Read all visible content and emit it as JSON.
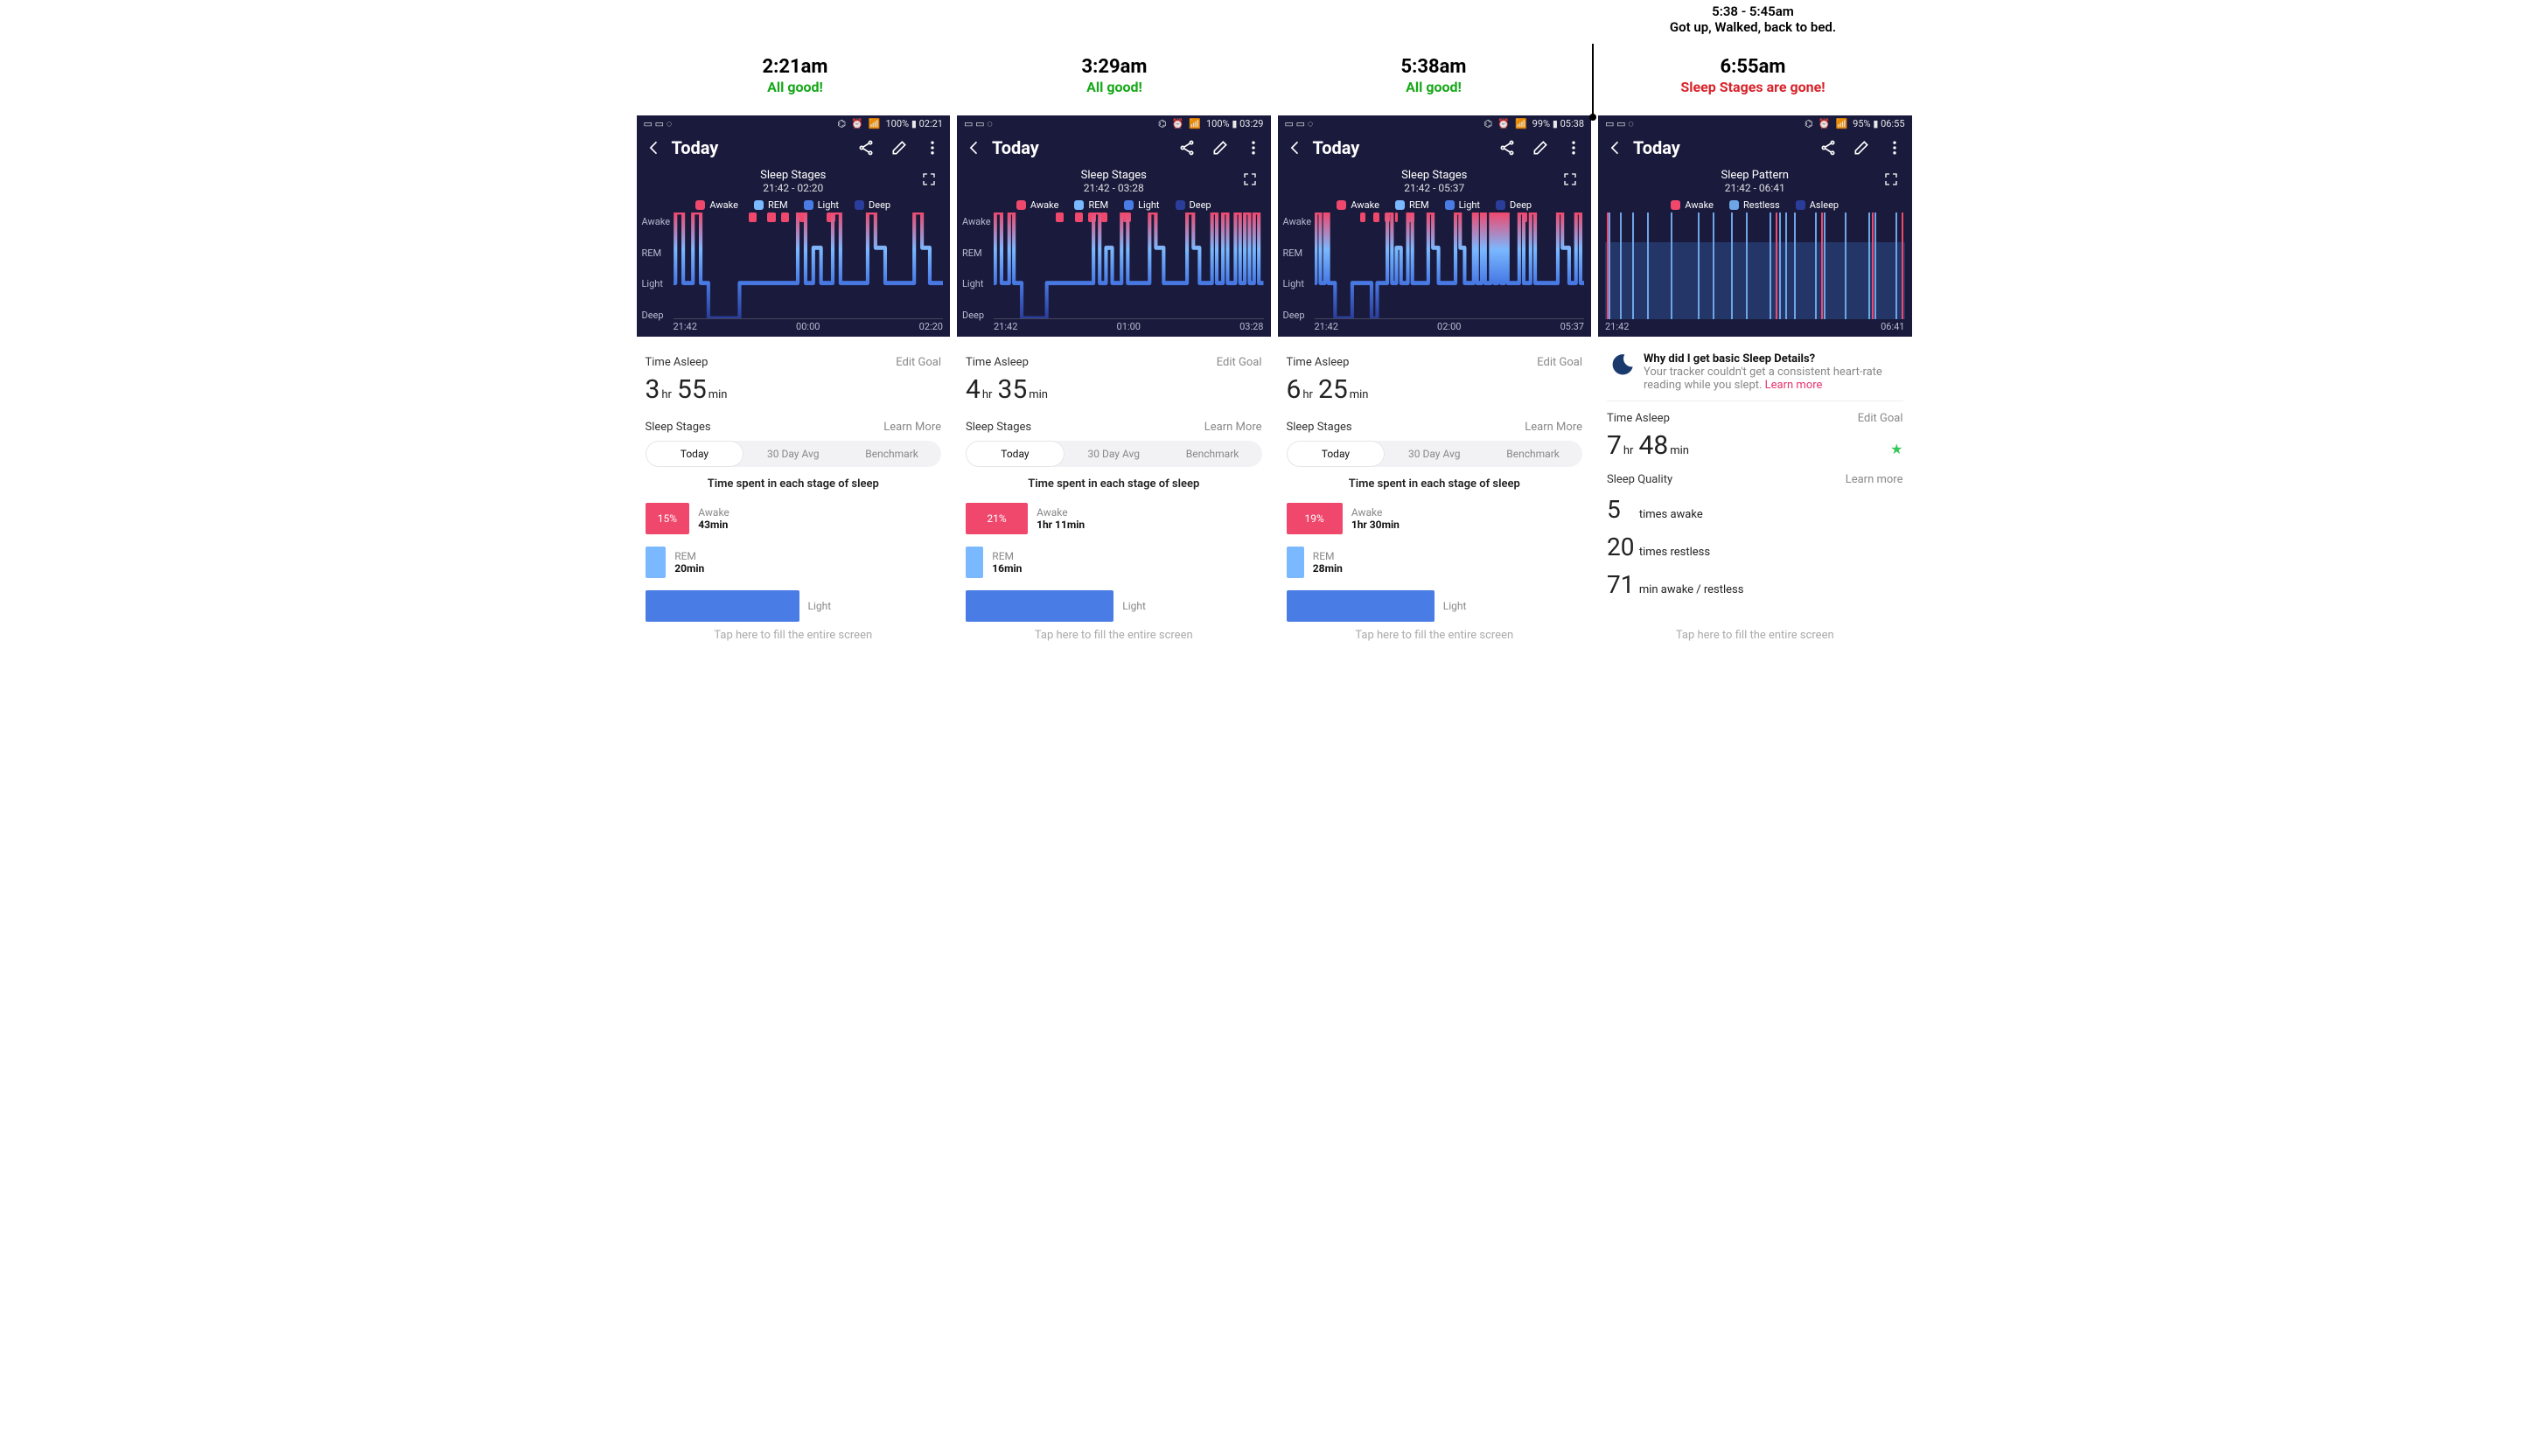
{
  "colors": {
    "awake": "#f0486d",
    "rem": "#7ab8ff",
    "light": "#4a7ce6",
    "deep": "#2a3d9a",
    "restless": "#6da5e6",
    "asleep": "#2a3d9a",
    "panel_fill": "#2e4d8a"
  },
  "callout": {
    "time": "5:38 - 5:45am",
    "note": "Got up, Walked, back to bed."
  },
  "phones": [
    {
      "ann_time": "2:21am",
      "ann_status": "All good!",
      "ann_color": "green",
      "status_right": "100% ▮ 02:21",
      "appbar_title": "Today",
      "chart_title": "Sleep Stages",
      "chart_range": "21:42 - 02:20",
      "legend": [
        "Awake",
        "REM",
        "Light",
        "Deep"
      ],
      "xticks": [
        "21:42",
        "00:00",
        "02:20"
      ],
      "ylabels": [
        "Awake",
        "REM",
        "Light",
        "Deep"
      ],
      "time_asleep_label": "Time Asleep",
      "edit_goal": "Edit Goal",
      "time_asleep": {
        "h": "3",
        "m": "55"
      },
      "stages_label": "Sleep Stages",
      "learn_more": "Learn More",
      "tabs": [
        "Today",
        "30 Day Avg",
        "Benchmark"
      ],
      "tabs_caption": "Time spent in each stage of sleep",
      "stage_rows": [
        {
          "pct": 15,
          "pct_label": "15%",
          "color": "#f0486d",
          "name": "Awake",
          "dur": "43min"
        },
        {
          "pct": 7,
          "pct_label": "",
          "color": "#7ab8ff",
          "name": "REM",
          "dur": "20min"
        },
        {
          "pct": 52,
          "pct_label": "",
          "color": "#4a7ce6",
          "name": "Light",
          "dur": ""
        }
      ],
      "footer": "Tap here to fill the entire screen"
    },
    {
      "ann_time": "3:29am",
      "ann_status": "All good!",
      "ann_color": "green",
      "status_right": "100% ▮ 03:29",
      "appbar_title": "Today",
      "chart_title": "Sleep Stages",
      "chart_range": "21:42 - 03:28",
      "legend": [
        "Awake",
        "REM",
        "Light",
        "Deep"
      ],
      "xticks": [
        "21:42",
        "01:00",
        "03:28"
      ],
      "ylabels": [
        "Awake",
        "REM",
        "Light",
        "Deep"
      ],
      "time_asleep_label": "Time Asleep",
      "edit_goal": "Edit Goal",
      "time_asleep": {
        "h": "4",
        "m": "35"
      },
      "stages_label": "Sleep Stages",
      "learn_more": "Learn More",
      "tabs": [
        "Today",
        "30 Day Avg",
        "Benchmark"
      ],
      "tabs_caption": "Time spent in each stage of sleep",
      "stage_rows": [
        {
          "pct": 21,
          "pct_label": "21%",
          "color": "#f0486d",
          "name": "Awake",
          "dur": "1hr 11min"
        },
        {
          "pct": 6,
          "pct_label": "",
          "color": "#7ab8ff",
          "name": "REM",
          "dur": "16min"
        },
        {
          "pct": 50,
          "pct_label": "",
          "color": "#4a7ce6",
          "name": "Light",
          "dur": ""
        }
      ],
      "footer": "Tap here to fill the entire screen"
    },
    {
      "ann_time": "5:38am",
      "ann_status": "All good!",
      "ann_color": "green",
      "status_right": "99% ▮ 05:38",
      "appbar_title": "Today",
      "chart_title": "Sleep Stages",
      "chart_range": "21:42 - 05:37",
      "legend": [
        "Awake",
        "REM",
        "Light",
        "Deep"
      ],
      "xticks": [
        "21:42",
        "02:00",
        "05:37"
      ],
      "ylabels": [
        "Awake",
        "REM",
        "Light",
        "Deep"
      ],
      "time_asleep_label": "Time Asleep",
      "edit_goal": "Edit Goal",
      "time_asleep": {
        "h": "6",
        "m": "25"
      },
      "stages_label": "Sleep Stages",
      "learn_more": "Learn More",
      "tabs": [
        "Today",
        "30 Day Avg",
        "Benchmark"
      ],
      "tabs_caption": "Time spent in each stage of sleep",
      "stage_rows": [
        {
          "pct": 19,
          "pct_label": "19%",
          "color": "#f0486d",
          "name": "Awake",
          "dur": "1hr 30min"
        },
        {
          "pct": 6,
          "pct_label": "",
          "color": "#7ab8ff",
          "name": "REM",
          "dur": "28min"
        },
        {
          "pct": 50,
          "pct_label": "",
          "color": "#4a7ce6",
          "name": "Light",
          "dur": ""
        }
      ],
      "footer": "Tap here to fill the entire screen"
    },
    {
      "ann_time": "6:55am",
      "ann_status": "Sleep Stages are gone!",
      "ann_color": "red",
      "status_right": "95% ▮ 06:55",
      "appbar_title": "Today",
      "chart_title": "Sleep Pattern",
      "chart_range": "21:42 - 06:41",
      "legend": [
        "Awake",
        "Restless",
        "Asleep"
      ],
      "xticks": [
        "21:42",
        "",
        "06:41"
      ],
      "notice": {
        "heading": "Why did I get basic Sleep Details?",
        "detail_a": "Your tracker couldn't get a consistent heart-rate reading while you slept. ",
        "link": "Learn more"
      },
      "time_asleep_label": "Time Asleep",
      "edit_goal": "Edit Goal",
      "time_asleep": {
        "h": "7",
        "m": "48"
      },
      "sq_label": "Sleep Quality",
      "learn_more": "Learn more",
      "sq_rows": [
        {
          "n": "5",
          "t": " times awake"
        },
        {
          "n": "20",
          "t": " times restless"
        },
        {
          "n": "71",
          "t": " min awake / restless"
        }
      ],
      "footer": "Tap here to fill the entire screen"
    }
  ],
  "chart_data": [
    {
      "type": "step-line",
      "title": "Sleep Stages",
      "time_range": "21:42 - 02:20",
      "x_range_minutes": [
        0,
        278
      ],
      "x_ticks": [
        "21:42",
        "00:00",
        "02:20"
      ],
      "y_levels": [
        "Awake",
        "REM",
        "Light",
        "Deep"
      ],
      "legend": [
        {
          "name": "Awake",
          "color": "#f0486d"
        },
        {
          "name": "REM",
          "color": "#7ab8ff"
        },
        {
          "name": "Light",
          "color": "#4a7ce6"
        },
        {
          "name": "Deep",
          "color": "#2a3d9a"
        }
      ],
      "awake_markers": [
        [
          28,
          31
        ],
        [
          35,
          38
        ],
        [
          40,
          43
        ],
        [
          47,
          49
        ],
        [
          57,
          60
        ],
        [
          132,
          134
        ],
        [
          204,
          207
        ]
      ],
      "steps": [
        [
          0,
          "Light"
        ],
        [
          2,
          "Awake"
        ],
        [
          10,
          "Light"
        ],
        [
          20,
          "Awake"
        ],
        [
          28,
          "Light"
        ],
        [
          36,
          "Deep"
        ],
        [
          68,
          "Light"
        ],
        [
          128,
          "Awake"
        ],
        [
          136,
          "Light"
        ],
        [
          144,
          "REM"
        ],
        [
          152,
          "Light"
        ],
        [
          164,
          "Awake"
        ],
        [
          172,
          "Light"
        ],
        [
          200,
          "Awake"
        ],
        [
          208,
          "REM"
        ],
        [
          218,
          "Light"
        ],
        [
          248,
          "Awake"
        ],
        [
          256,
          "REM"
        ],
        [
          264,
          "Light"
        ],
        [
          278,
          "Light"
        ]
      ]
    },
    {
      "type": "step-line",
      "title": "Sleep Stages",
      "time_range": "21:42 - 03:28",
      "x_range_minutes": [
        0,
        346
      ],
      "x_ticks": [
        "21:42",
        "01:00",
        "03:28"
      ],
      "y_levels": [
        "Awake",
        "REM",
        "Light",
        "Deep"
      ],
      "legend": [
        {
          "name": "Awake",
          "color": "#f0486d"
        },
        {
          "name": "REM",
          "color": "#7ab8ff"
        },
        {
          "name": "Light",
          "color": "#4a7ce6"
        },
        {
          "name": "Deep",
          "color": "#2a3d9a"
        }
      ],
      "awake_markers": [
        [
          23,
          26
        ],
        [
          30,
          33
        ],
        [
          35,
          38
        ],
        [
          40,
          42
        ],
        [
          48,
          51
        ],
        [
          106,
          108
        ],
        [
          164,
          166
        ]
      ],
      "steps": [
        [
          0,
          "Light"
        ],
        [
          2,
          "Awake"
        ],
        [
          10,
          "Light"
        ],
        [
          20,
          "Awake"
        ],
        [
          26,
          "Light"
        ],
        [
          36,
          "Deep"
        ],
        [
          68,
          "Light"
        ],
        [
          128,
          "Awake"
        ],
        [
          136,
          "Light"
        ],
        [
          144,
          "REM"
        ],
        [
          152,
          "Light"
        ],
        [
          164,
          "Awake"
        ],
        [
          172,
          "Light"
        ],
        [
          200,
          "Awake"
        ],
        [
          208,
          "REM"
        ],
        [
          218,
          "Light"
        ],
        [
          248,
          "Awake"
        ],
        [
          256,
          "REM"
        ],
        [
          264,
          "Light"
        ],
        [
          280,
          "Awake"
        ],
        [
          286,
          "Light"
        ],
        [
          294,
          "Awake"
        ],
        [
          300,
          "Light"
        ],
        [
          310,
          "Awake"
        ],
        [
          316,
          "Light"
        ],
        [
          322,
          "Awake"
        ],
        [
          328,
          "Light"
        ],
        [
          334,
          "Awake"
        ],
        [
          340,
          "Light"
        ],
        [
          346,
          "Light"
        ]
      ]
    },
    {
      "type": "step-line",
      "title": "Sleep Stages",
      "time_range": "21:42 - 05:37",
      "x_range_minutes": [
        0,
        475
      ],
      "x_ticks": [
        "21:42",
        "02:00",
        "05:37"
      ],
      "y_levels": [
        "Awake",
        "REM",
        "Light",
        "Deep"
      ],
      "legend": [
        {
          "name": "Awake",
          "color": "#f0486d"
        },
        {
          "name": "REM",
          "color": "#7ab8ff"
        },
        {
          "name": "Light",
          "color": "#4a7ce6"
        },
        {
          "name": "Deep",
          "color": "#2a3d9a"
        }
      ],
      "awake_markers": [
        [
          17,
          19
        ],
        [
          22,
          24
        ],
        [
          26,
          28
        ],
        [
          30,
          31
        ],
        [
          35,
          37
        ],
        [
          78,
          79
        ],
        [
          120,
          121
        ]
      ],
      "steps": [
        [
          0,
          "Light"
        ],
        [
          2,
          "Awake"
        ],
        [
          10,
          "Light"
        ],
        [
          18,
          "Awake"
        ],
        [
          24,
          "Light"
        ],
        [
          36,
          "Deep"
        ],
        [
          66,
          "Light"
        ],
        [
          100,
          "Deep"
        ],
        [
          110,
          "Light"
        ],
        [
          128,
          "Awake"
        ],
        [
          136,
          "Light"
        ],
        [
          144,
          "REM"
        ],
        [
          152,
          "Light"
        ],
        [
          164,
          "Awake"
        ],
        [
          172,
          "Light"
        ],
        [
          200,
          "Awake"
        ],
        [
          208,
          "REM"
        ],
        [
          218,
          "Light"
        ],
        [
          248,
          "Awake"
        ],
        [
          256,
          "REM"
        ],
        [
          264,
          "Light"
        ],
        [
          280,
          "Awake"
        ],
        [
          286,
          "Light"
        ],
        [
          294,
          "Awake"
        ],
        [
          300,
          "Light"
        ],
        [
          310,
          "Awake"
        ],
        [
          316,
          "Light"
        ],
        [
          322,
          "Awake"
        ],
        [
          328,
          "Light"
        ],
        [
          334,
          "Awake"
        ],
        [
          340,
          "Light"
        ],
        [
          360,
          "Awake"
        ],
        [
          368,
          "Light"
        ],
        [
          380,
          "Awake"
        ],
        [
          388,
          "Light"
        ],
        [
          428,
          "Awake"
        ],
        [
          436,
          "REM"
        ],
        [
          448,
          "Light"
        ],
        [
          460,
          "Awake"
        ],
        [
          468,
          "Light"
        ],
        [
          475,
          "Light"
        ]
      ]
    },
    {
      "type": "vertical-bars",
      "title": "Sleep Pattern",
      "time_range": "21:42 - 06:41",
      "x_range_minutes": [
        0,
        539
      ],
      "x_ticks": [
        "21:42",
        "06:41"
      ],
      "legend": [
        {
          "name": "Awake",
          "color": "#f0486d"
        },
        {
          "name": "Restless",
          "color": "#6da5e6"
        },
        {
          "name": "Asleep",
          "color": "#2a3d9a"
        }
      ],
      "asleep_fill_height_pct": 72,
      "bars": [
        {
          "x_pct": 0.5,
          "w_pct": 0.6,
          "h_pct": 100,
          "color": "#f0486d"
        },
        {
          "x_pct": 1.3,
          "w_pct": 0.6,
          "h_pct": 100,
          "color": "#6da5e6"
        },
        {
          "x_pct": 5,
          "w_pct": 0.6,
          "h_pct": 100,
          "color": "#6da5e6"
        },
        {
          "x_pct": 9,
          "w_pct": 0.6,
          "h_pct": 100,
          "color": "#6da5e6"
        },
        {
          "x_pct": 14,
          "w_pct": 0.6,
          "h_pct": 100,
          "color": "#6da5e6"
        },
        {
          "x_pct": 22,
          "w_pct": 0.6,
          "h_pct": 100,
          "color": "#6da5e6"
        },
        {
          "x_pct": 31,
          "w_pct": 0.6,
          "h_pct": 100,
          "color": "#6da5e6"
        },
        {
          "x_pct": 36,
          "w_pct": 0.6,
          "h_pct": 100,
          "color": "#6da5e6"
        },
        {
          "x_pct": 42,
          "w_pct": 0.6,
          "h_pct": 100,
          "color": "#6da5e6"
        },
        {
          "x_pct": 47,
          "w_pct": 0.6,
          "h_pct": 100,
          "color": "#6da5e6"
        },
        {
          "x_pct": 55,
          "w_pct": 0.6,
          "h_pct": 100,
          "color": "#6da5e6"
        },
        {
          "x_pct": 57,
          "w_pct": 0.6,
          "h_pct": 100,
          "color": "#f0486d"
        },
        {
          "x_pct": 58,
          "w_pct": 0.6,
          "h_pct": 100,
          "color": "#6da5e6"
        },
        {
          "x_pct": 60,
          "w_pct": 0.6,
          "h_pct": 100,
          "color": "#6da5e6"
        },
        {
          "x_pct": 63,
          "w_pct": 0.6,
          "h_pct": 100,
          "color": "#6da5e6"
        },
        {
          "x_pct": 70,
          "w_pct": 0.6,
          "h_pct": 100,
          "color": "#6da5e6"
        },
        {
          "x_pct": 72,
          "w_pct": 0.6,
          "h_pct": 100,
          "color": "#f0486d"
        },
        {
          "x_pct": 73,
          "w_pct": 0.6,
          "h_pct": 100,
          "color": "#6da5e6"
        },
        {
          "x_pct": 80,
          "w_pct": 0.6,
          "h_pct": 100,
          "color": "#6da5e6"
        },
        {
          "x_pct": 88,
          "w_pct": 0.6,
          "h_pct": 100,
          "color": "#6da5e6"
        },
        {
          "x_pct": 89,
          "w_pct": 0.6,
          "h_pct": 100,
          "color": "#f0486d"
        },
        {
          "x_pct": 90,
          "w_pct": 0.6,
          "h_pct": 100,
          "color": "#6da5e6"
        },
        {
          "x_pct": 97,
          "w_pct": 0.6,
          "h_pct": 100,
          "color": "#6da5e6"
        },
        {
          "x_pct": 99,
          "w_pct": 0.6,
          "h_pct": 100,
          "color": "#f0486d"
        }
      ]
    }
  ],
  "units": {
    "hr": "hr",
    "min": "min"
  }
}
